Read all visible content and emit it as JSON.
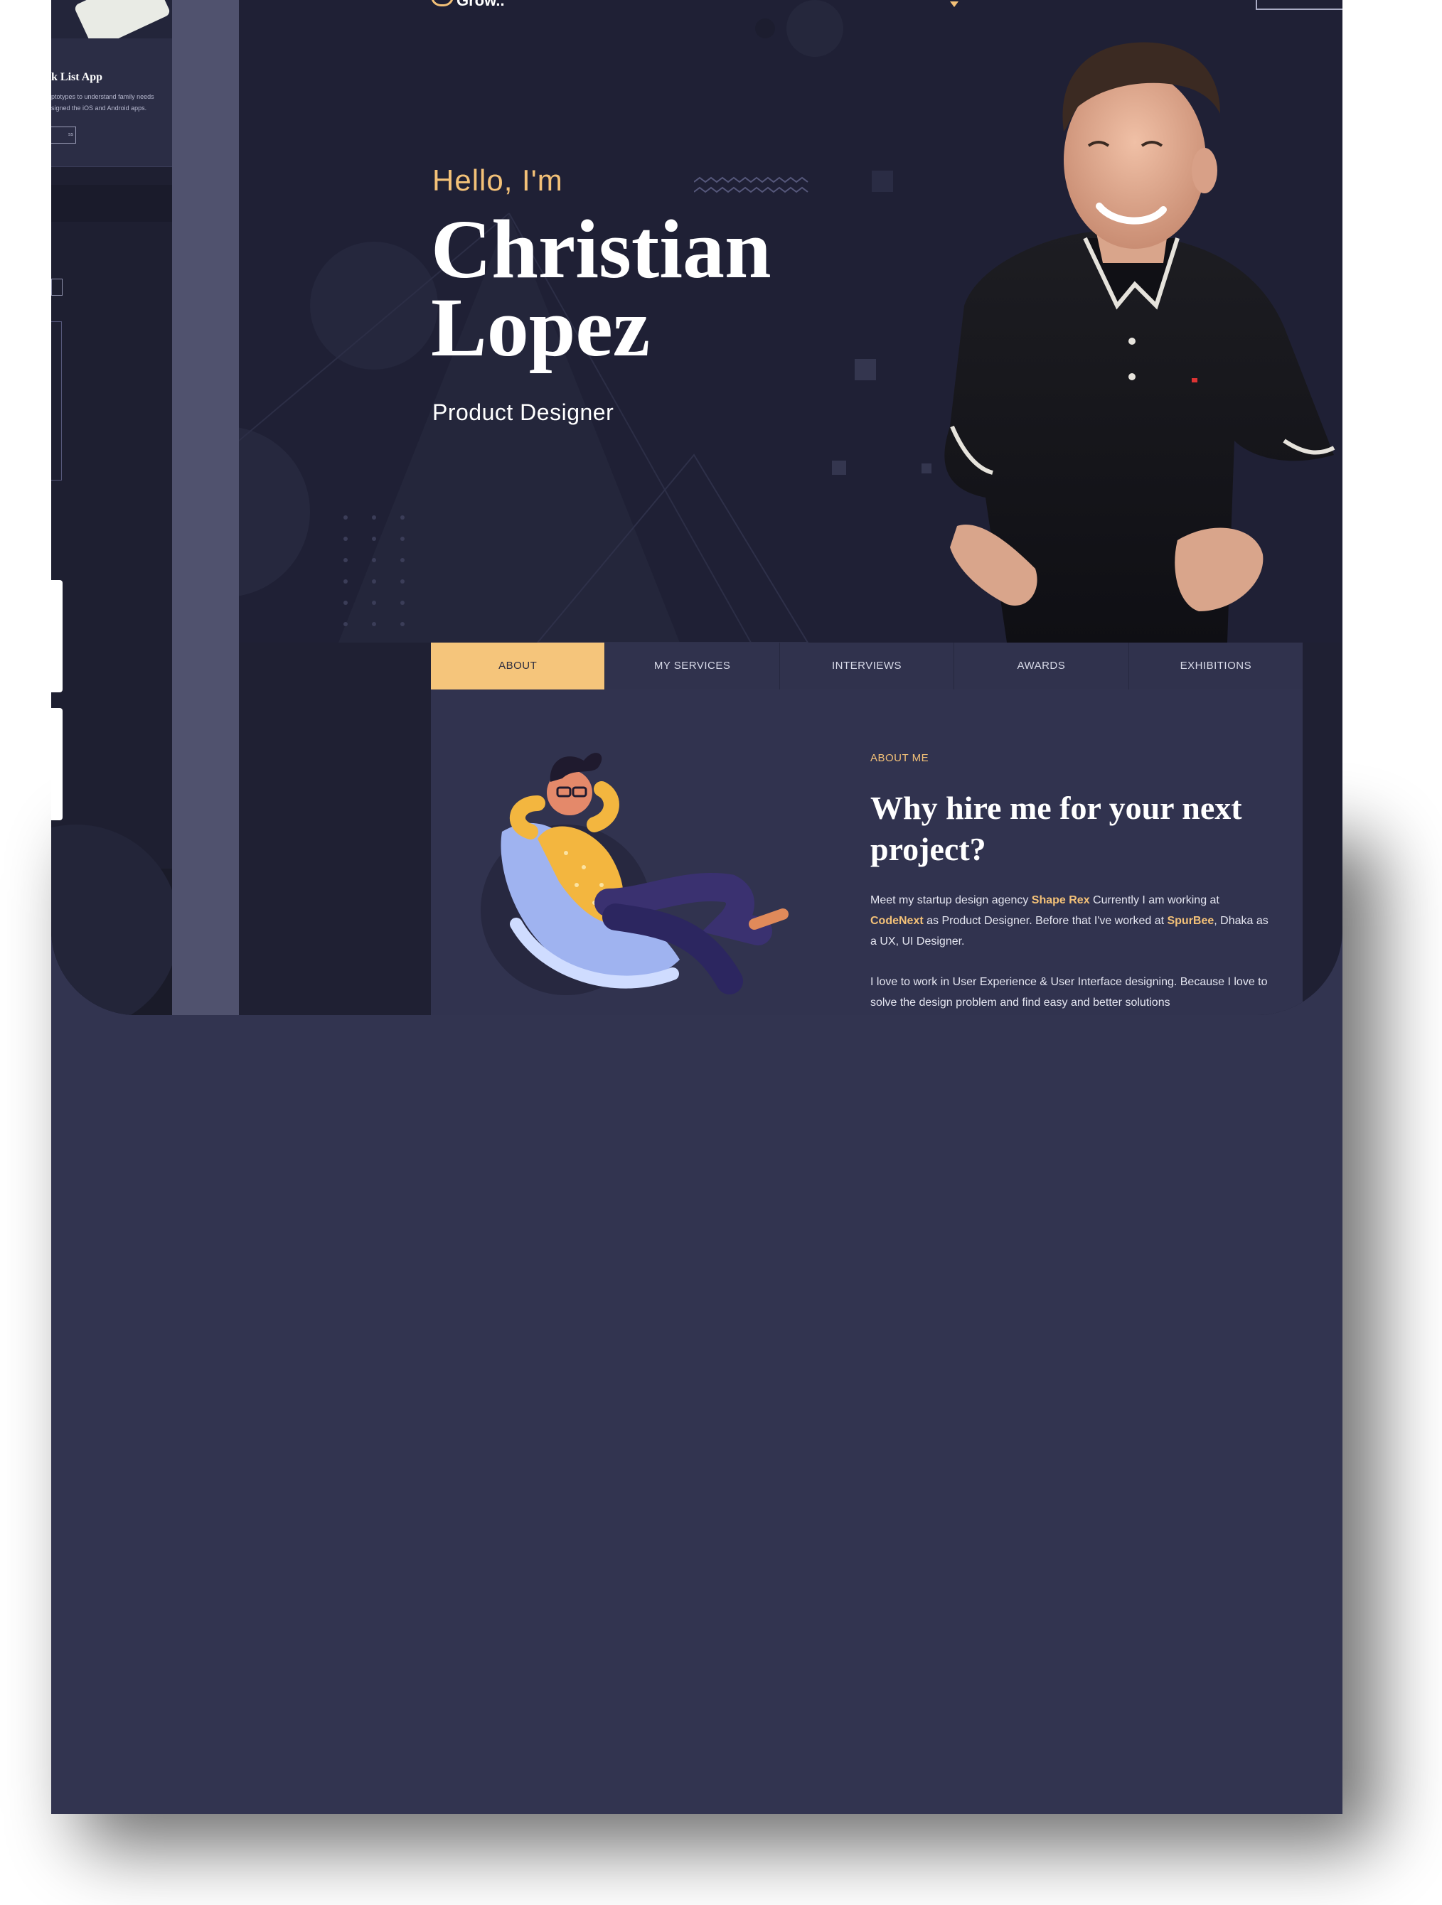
{
  "side_preview": {
    "card_title": "k List App",
    "card_desc_line1": "ptotypes to understand family needs",
    "card_desc_line2": "signed the iOS and Android apps.",
    "card_button": "ss"
  },
  "header": {
    "logo_text": "Grow.."
  },
  "hero": {
    "greeting": "Hello, I'm",
    "name_line1": "Christian",
    "name_line2": "Lopez",
    "role": "Product Designer"
  },
  "tabs": [
    {
      "label": "ABOUT",
      "active": true
    },
    {
      "label": "MY SERVICES",
      "active": false
    },
    {
      "label": "INTERVIEWS",
      "active": false
    },
    {
      "label": "AWARDS",
      "active": false
    },
    {
      "label": "EXHIBITIONS",
      "active": false
    }
  ],
  "about": {
    "kicker": "ABOUT ME",
    "headline": "Why hire me for your next project?",
    "p1_a": "Meet my startup design agency ",
    "p1_company1": "Shape Rex",
    "p1_b": " Currently I am working at ",
    "p1_company2": "CodeNext",
    "p1_c": " as Product Designer. Before that I've worked at ",
    "p1_company3": "SpurBee",
    "p1_d": ", Dhaka as a UX, UI Designer.",
    "p2": "I love to work in User Experience & User Interface designing. Because I love to solve the design problem  and find easy and better solutions"
  },
  "colors": {
    "accent": "#f3c178",
    "hero_bg": "#1f2035",
    "panel_bg": "#31334f",
    "page_bg": "#323450"
  }
}
